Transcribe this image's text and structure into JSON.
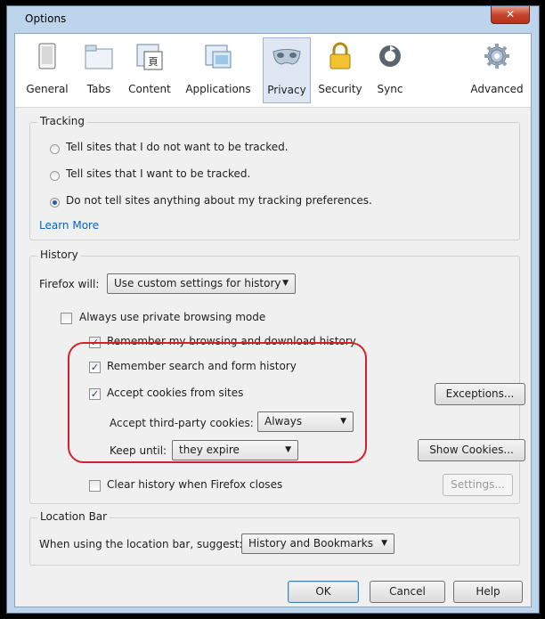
{
  "window": {
    "title": "Options",
    "close_glyph": "✕"
  },
  "toolbar": {
    "panes": [
      {
        "label": "General",
        "icon": "general-icon"
      },
      {
        "label": "Tabs",
        "icon": "tabs-icon"
      },
      {
        "label": "Content",
        "icon": "content-icon"
      },
      {
        "label": "Applications",
        "icon": "applications-icon"
      },
      {
        "label": "Privacy",
        "icon": "privacy-mask-icon",
        "selected": true
      },
      {
        "label": "Security",
        "icon": "padlock-icon"
      },
      {
        "label": "Sync",
        "icon": "sync-icon"
      },
      {
        "label": "Advanced",
        "icon": "gear-icon"
      }
    ]
  },
  "tracking": {
    "title": "Tracking",
    "options": [
      {
        "label": "Tell sites that I do not want to be tracked.",
        "checked": false
      },
      {
        "label": "Tell sites that I want to be tracked.",
        "checked": false
      },
      {
        "label": "Do not tell sites anything about my tracking preferences.",
        "checked": true
      }
    ],
    "learn_more": "Learn More"
  },
  "history": {
    "title": "History",
    "firefox_will_label": "Firefox will:",
    "firefox_will_value": "Use custom settings for history",
    "private_mode": {
      "label": "Always use private browsing mode",
      "checked": false
    },
    "remember_browsing": {
      "label": "Remember my browsing and download history",
      "checked": true
    },
    "remember_search": {
      "label": "Remember search and form history",
      "checked": true
    },
    "accept_cookies": {
      "label": "Accept cookies from sites",
      "checked": true
    },
    "exceptions_button": "Exceptions...",
    "third_party_label": "Accept third-party cookies:",
    "third_party_value": "Always",
    "keep_until_label": "Keep until:",
    "keep_until_value": "they expire",
    "show_cookies_button": "Show Cookies...",
    "clear_history": {
      "label": "Clear history when Firefox closes",
      "checked": false
    },
    "settings_button": "Settings..."
  },
  "location_bar": {
    "title": "Location Bar",
    "suggest_label": "When using the location bar, suggest:",
    "suggest_value": "History and Bookmarks"
  },
  "footer": {
    "ok": "OK",
    "cancel": "Cancel",
    "help": "Help"
  },
  "colors": {
    "accent": "#0066cc",
    "highlight_box": "#d4202a",
    "title_bar": "#bcd4ec"
  }
}
